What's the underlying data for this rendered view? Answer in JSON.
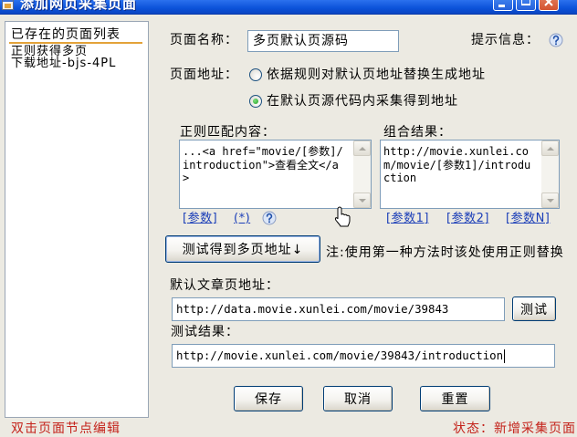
{
  "window": {
    "title": "添加网页采集页面"
  },
  "sidebar": {
    "root_label": "已存在的页面列表",
    "items": [
      {
        "label_lines": [
          "正则获得多页",
          "下载地址-bjs-4PL"
        ]
      }
    ]
  },
  "form": {
    "page_name": {
      "label": "页面名称：",
      "value": "多页默认页源码"
    },
    "hint": {
      "label": "提示信息："
    },
    "page_address": {
      "label": "页面地址：",
      "options": [
        {
          "label": "依据规则对默认页地址替换生成地址",
          "checked": false
        },
        {
          "label": "在默认页源代码内采集得到地址",
          "checked": true
        }
      ]
    },
    "regex": {
      "label": "正则匹配内容：",
      "value": "...<a href=\"movie/[参数]/introduction\">查看全文</a>",
      "links": [
        "[参数]",
        "(*)"
      ]
    },
    "combined": {
      "label": "组合结果：",
      "value": "http://movie.xunlei.com/movie/[参数1]/introduction",
      "links": [
        "[参数1]",
        "[参数2]",
        "[参数N]"
      ]
    },
    "get_pages_button": "测试得到多页地址↓",
    "note": "注:使用第一种方法时该处使用正则替换",
    "default_url": {
      "label": "默认文章页地址：",
      "value": "http://data.movie.xunlei.com/movie/39843",
      "test_button": "测试"
    },
    "test_result": {
      "label": "测试结果：",
      "value": "http://movie.xunlei.com/movie/39843/introduction"
    }
  },
  "actions": {
    "save": "保存",
    "cancel": "取消",
    "reset": "重置"
  },
  "status_bar": {
    "hint": "双击页面节点编辑",
    "status": "状态：新增采集页面"
  },
  "icons": {
    "app": "window-app-icon",
    "help": "question-icon",
    "cursor": "hand-pointer-cursor",
    "scroll_up": "arrow-up-icon",
    "scroll_down": "arrow-down-icon",
    "minimize": "minimize-icon",
    "maximize": "maximize-icon",
    "close": "close-icon"
  },
  "colors": {
    "window_bg": "#ECEAE2",
    "link": "#1B3EB8",
    "status_text": "#C4231B",
    "input_border": "#7F9DB9",
    "button_border": "#003C74",
    "radio_dot": "#23A023",
    "tree_underline": "#E3A33A",
    "close_button": "#D4532F"
  }
}
